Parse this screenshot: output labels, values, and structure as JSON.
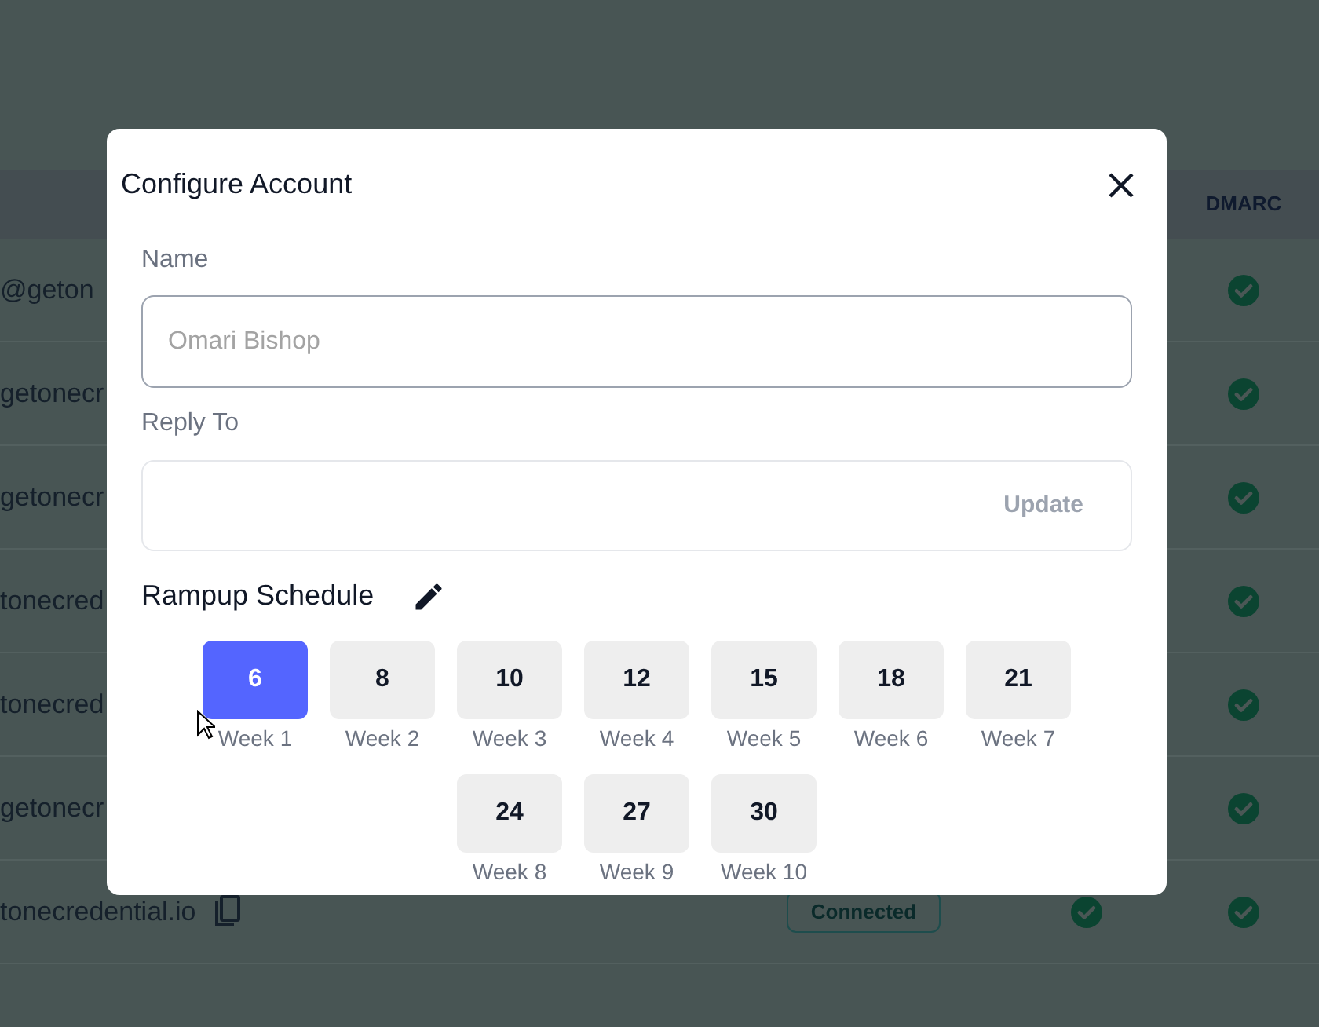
{
  "table": {
    "columns": [
      {
        "label": "DMARC"
      }
    ],
    "rows": [
      {
        "email": "@geton",
        "dmarc": true
      },
      {
        "email": "getonecr",
        "dmarc": true
      },
      {
        "email": "getonecr",
        "dmarc": true
      },
      {
        "email": "tonecred",
        "dmarc": true
      },
      {
        "email": "tonecred",
        "dmarc": true
      },
      {
        "email": "getonecr",
        "dmarc": true
      },
      {
        "email": "tonecredential.io",
        "copy": true,
        "status": "Connected",
        "verified": true,
        "dmarc": true
      }
    ]
  },
  "dialog": {
    "title": "Configure Account",
    "name": {
      "label": "Name",
      "placeholder": "Omari Bishop"
    },
    "reply_to": {
      "label": "Reply To",
      "button": {
        "label": "Update",
        "disabled": true
      }
    },
    "schedule": {
      "label": "Rampup Schedule",
      "weeks": [
        {
          "value": "6",
          "label": "Week 1",
          "selected": true
        },
        {
          "value": "8",
          "label": "Week 2",
          "selected": false
        },
        {
          "value": "10",
          "label": "Week 3",
          "selected": false
        },
        {
          "value": "12",
          "label": "Week 4",
          "selected": false
        },
        {
          "value": "15",
          "label": "Week 5",
          "selected": false
        },
        {
          "value": "18",
          "label": "Week 6",
          "selected": false
        },
        {
          "value": "21",
          "label": "Week 7",
          "selected": false
        },
        {
          "value": "24",
          "label": "Week 8",
          "selected": false
        },
        {
          "value": "27",
          "label": "Week 9",
          "selected": false
        },
        {
          "value": "30",
          "label": "Week 10",
          "selected": false
        }
      ]
    }
  }
}
